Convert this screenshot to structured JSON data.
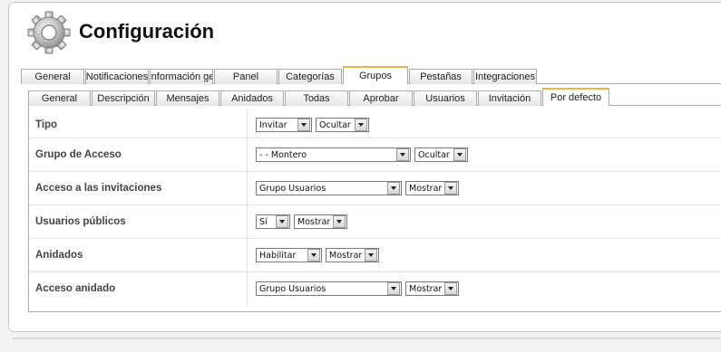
{
  "page": {
    "title": "Configuración"
  },
  "top_tabs": [
    {
      "label": "General",
      "active": false
    },
    {
      "label": "Notificaciones",
      "active": false
    },
    {
      "label": "Información ge",
      "active": false
    },
    {
      "label": "Panel",
      "active": false
    },
    {
      "label": "Categorías",
      "active": false
    },
    {
      "label": "Grupos",
      "active": true
    },
    {
      "label": "Pestañas",
      "active": false
    },
    {
      "label": "Integraciones",
      "active": false
    }
  ],
  "sub_tabs": [
    {
      "label": "General",
      "active": false
    },
    {
      "label": "Descripción",
      "active": false
    },
    {
      "label": "Mensajes",
      "active": false
    },
    {
      "label": "Anidados",
      "active": false
    },
    {
      "label": "Todas",
      "active": false
    },
    {
      "label": "Aprobar",
      "active": false
    },
    {
      "label": "Usuarios",
      "active": false
    },
    {
      "label": "Invitación",
      "active": false
    },
    {
      "label": "Por defecto",
      "active": true
    }
  ],
  "rows": [
    {
      "label": "Tipo",
      "value": "Invitar",
      "visibility": "Ocultar"
    },
    {
      "label": "Grupo de Acceso",
      "value": "- - Montero",
      "visibility": "Ocultar"
    },
    {
      "label": "Acceso a las invitaciones",
      "value": "Grupo Usuarios",
      "visibility": "Mostrar"
    },
    {
      "label": "Usuarios públicos",
      "value": "Sí",
      "visibility": "Mostrar"
    },
    {
      "label": "Anidados",
      "value": "Habilitar",
      "visibility": "Mostrar"
    },
    {
      "label": "Acceso anidado",
      "value": "Grupo Usuarios",
      "visibility": "Mostrar"
    }
  ]
}
